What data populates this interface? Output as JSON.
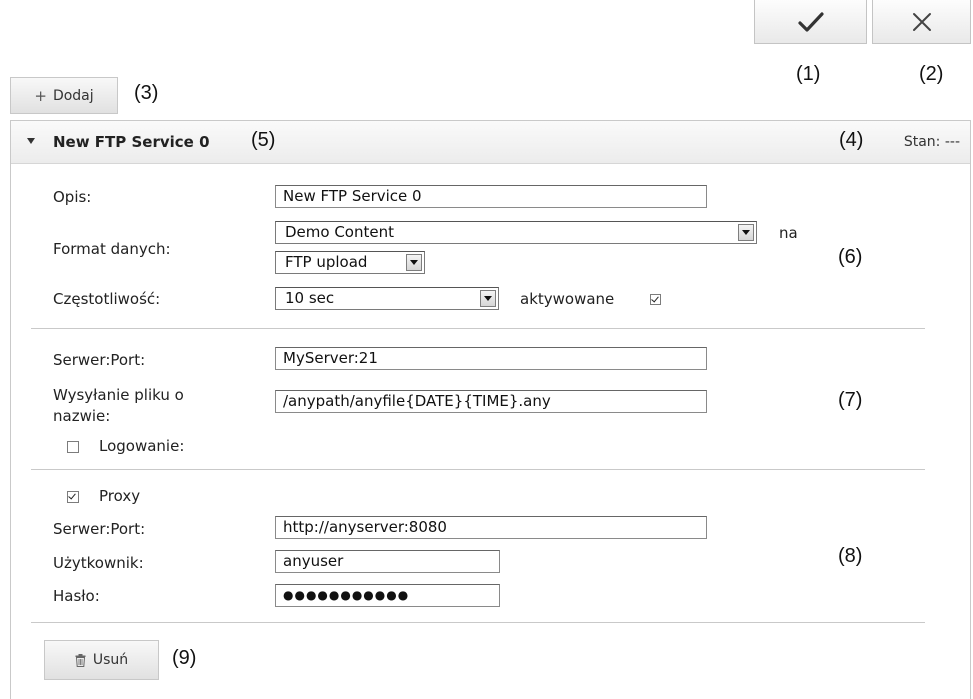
{
  "toolbar": {
    "confirm_icon": "checkmark-icon",
    "cancel_icon": "close-icon"
  },
  "callouts": {
    "c1": "(1)",
    "c2": "(2)",
    "c3": "(3)",
    "c4": "(4)",
    "c5": "(5)",
    "c6": "(6)",
    "c7": "(7)",
    "c8": "(8)",
    "c9": "(9)"
  },
  "add_button": {
    "icon": "+",
    "label": "Dodaj"
  },
  "service": {
    "title": "New FTP Service 0",
    "status_label": "Stan:",
    "status_value": "---"
  },
  "general": {
    "description_label": "Opis:",
    "description_value": "New FTP Service 0",
    "format_label": "Format danych:",
    "format_value": "Demo Content",
    "format_suffix": "na",
    "transfer_value": "FTP upload",
    "frequency_label": "Częstotliwość:",
    "frequency_value": "10 sec",
    "activated_label": "aktywowane",
    "activated_checked": true
  },
  "ftp": {
    "server_label": "Serwer:Port:",
    "server_value": "MyServer:21",
    "filename_label_line1": "Wysyłanie pliku o",
    "filename_label_line2": "nazwie:",
    "filename_value": "/anypath/anyfile{DATE}{TIME}.any",
    "login_label": "Logowanie:",
    "login_checked": false
  },
  "proxy": {
    "proxy_label": "Proxy",
    "proxy_checked": true,
    "server_label": "Serwer:Port:",
    "server_value": "http://anyserver:8080",
    "user_label": "Użytkownik:",
    "user_value": "anyuser",
    "password_label": "Hasło:",
    "password_value": "●●●●●●●●●●●"
  },
  "delete_button": {
    "label": "Usuń"
  },
  "colors": {
    "border": "#c9c9c9",
    "button_top": "#f8f8f8",
    "button_bottom": "#e1e1e1"
  }
}
